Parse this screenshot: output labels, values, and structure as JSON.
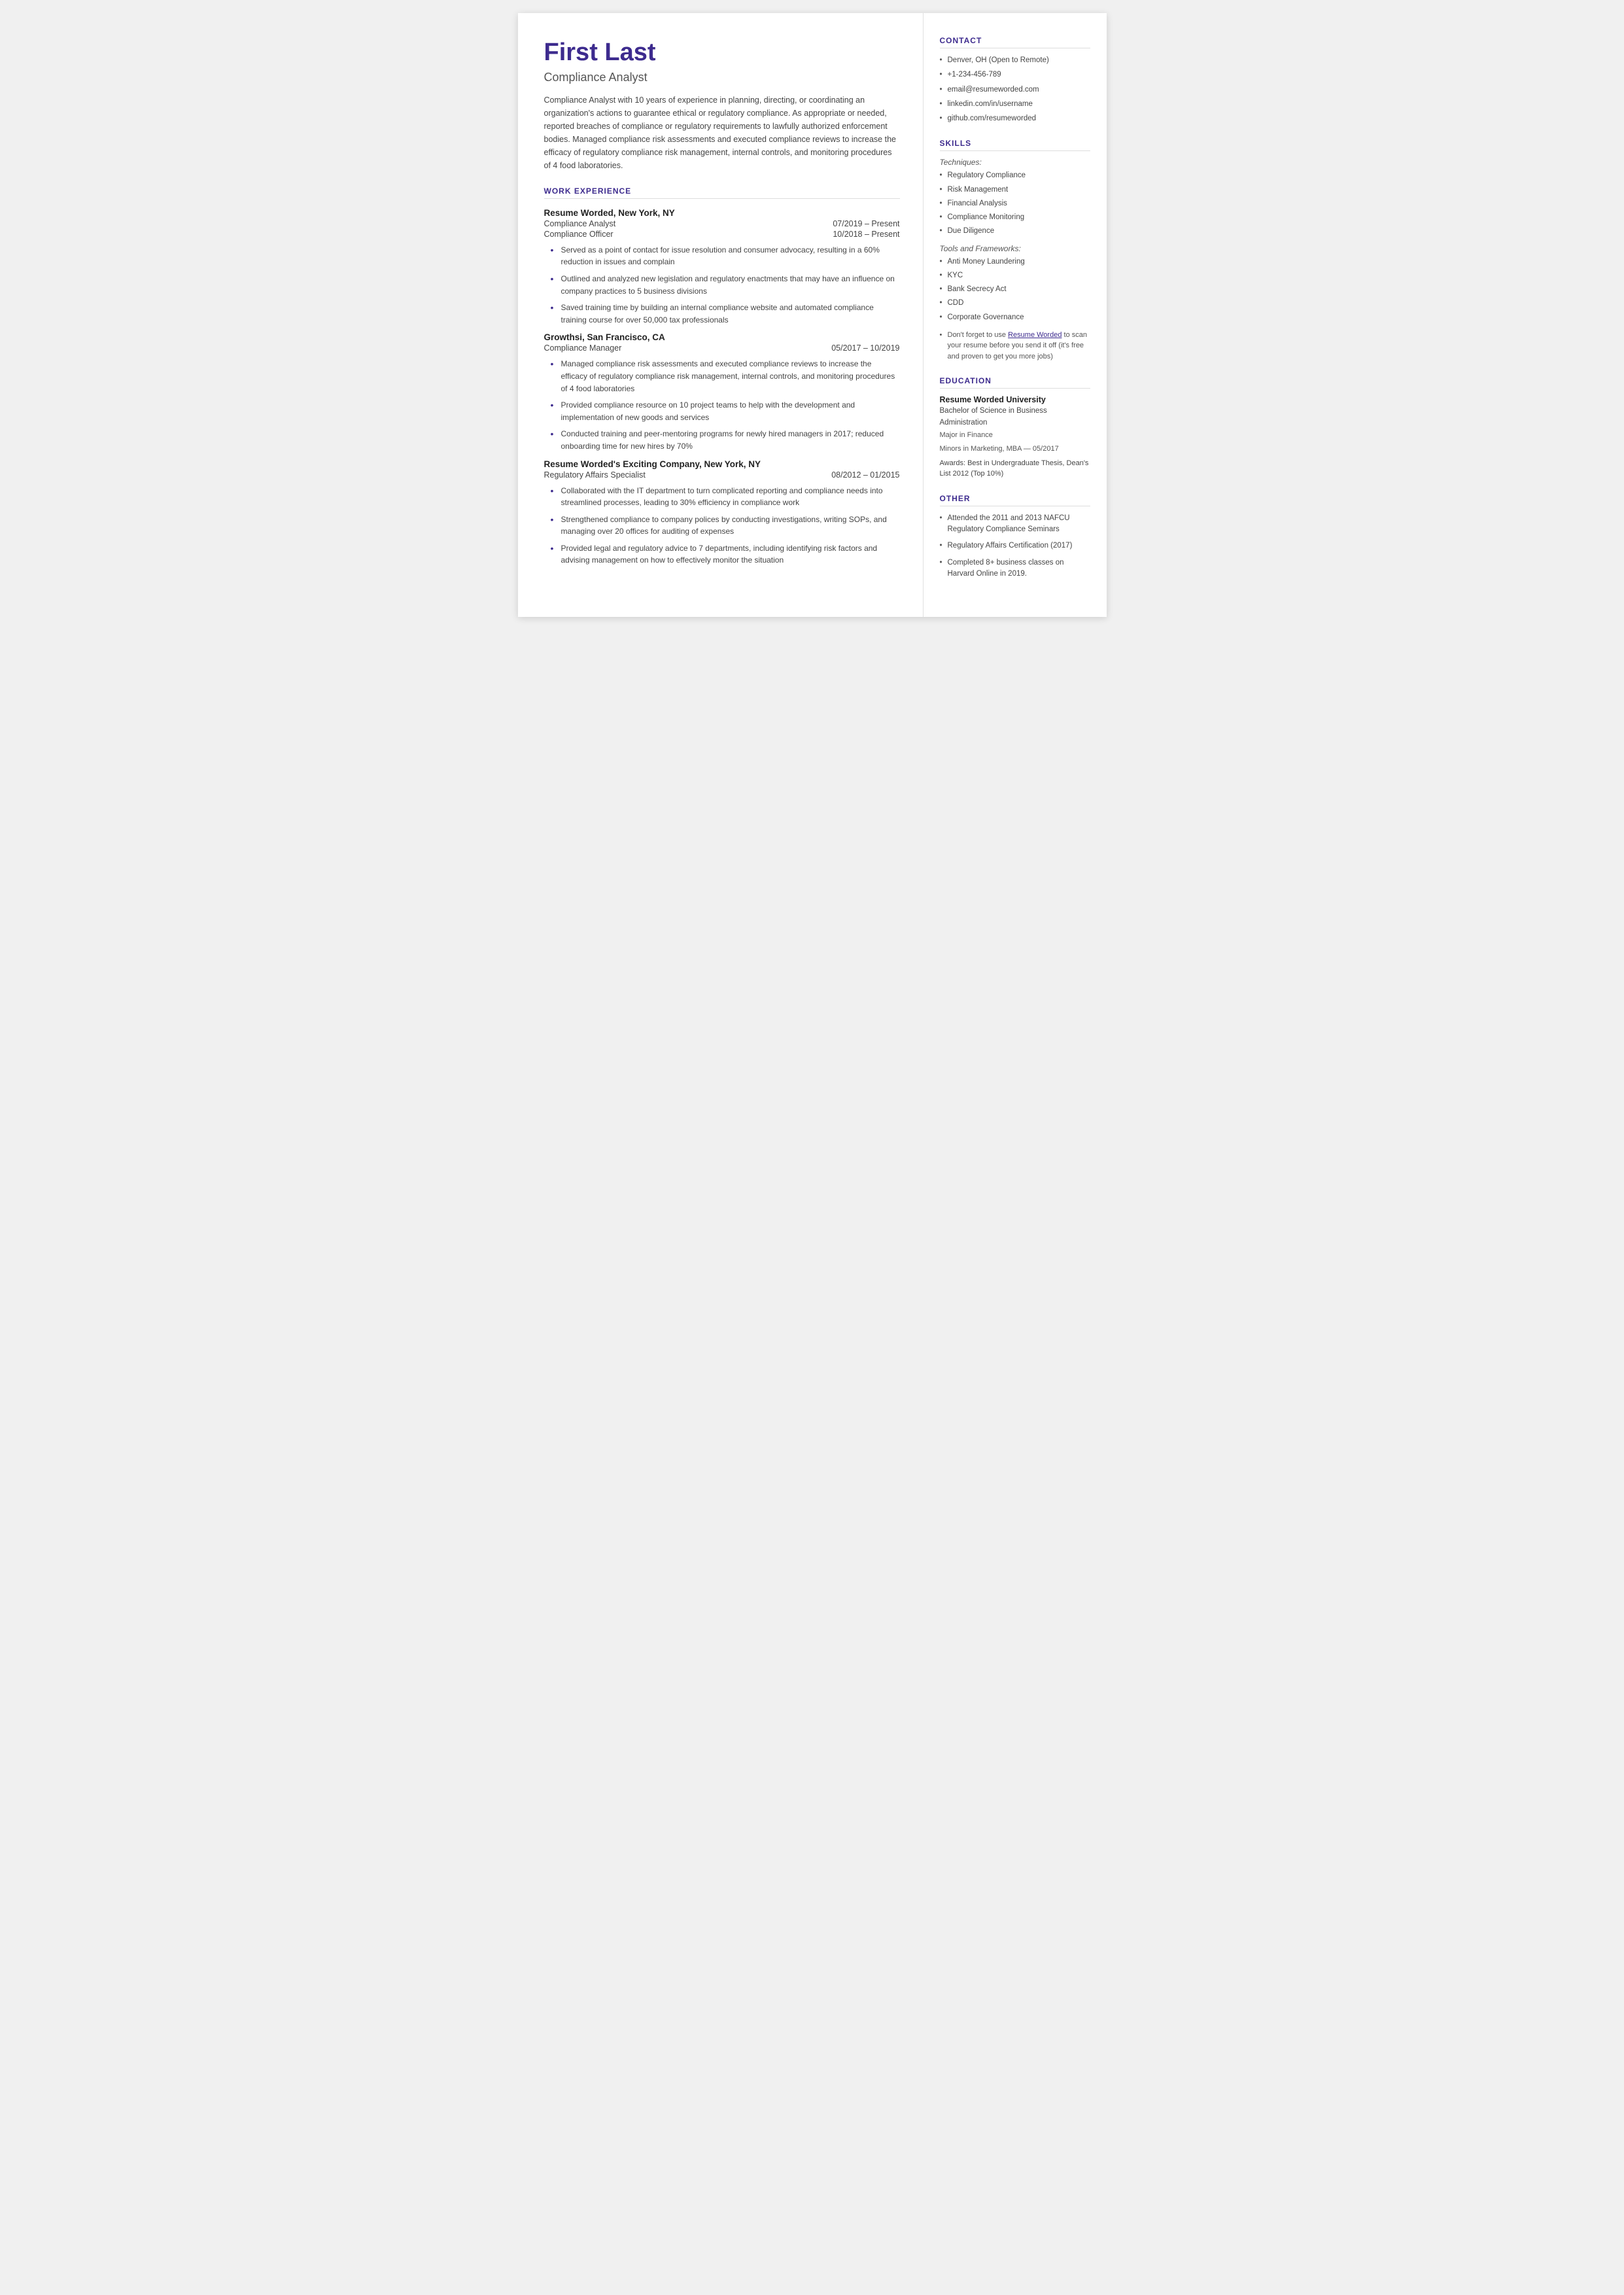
{
  "header": {
    "name": "First Last",
    "title": "Compliance Analyst",
    "summary": "Compliance Analyst with 10 years of experience in planning, directing, or coordinating an organization's actions to guarantee ethical or regulatory compliance. As appropriate or needed, reported breaches of compliance or regulatory requirements to lawfully authorized enforcement bodies. Managed compliance risk assessments and executed compliance reviews to increase the efficacy of regulatory compliance risk management, internal controls, and monitoring procedures of 4 food laboratories."
  },
  "work_experience": {
    "section_label": "WORK EXPERIENCE",
    "jobs": [
      {
        "company": "Resume Worded, New York, NY",
        "roles": [
          {
            "title": "Compliance Analyst",
            "dates": "07/2019 – Present"
          },
          {
            "title": "Compliance Officer",
            "dates": "10/2018 – Present"
          }
        ],
        "bullets": [
          "Served as a point of contact for issue resolution and consumer advocacy, resulting in a 60% reduction in issues and complain",
          "Outlined and analyzed new legislation and regulatory enactments that may have an influence on company practices to 5 business divisions",
          "Saved training time by building an internal compliance website and automated compliance training course for over 50,000 tax professionals"
        ]
      },
      {
        "company": "Growthsi, San Francisco, CA",
        "roles": [
          {
            "title": "Compliance Manager",
            "dates": "05/2017 – 10/2019"
          }
        ],
        "bullets": [
          "Managed compliance risk assessments and executed compliance reviews to increase the efficacy of regulatory compliance risk management, internal controls, and monitoring procedures of 4 food laboratories",
          "Provided compliance resource on 10 project teams to help with the development and implementation of new goods and services",
          "Conducted training and peer-mentoring programs for newly hired managers in 2017; reduced onboarding time for new hires by 70%"
        ]
      },
      {
        "company": "Resume Worded's Exciting Company, New York, NY",
        "roles": [
          {
            "title": "Regulatory Affairs Specialist",
            "dates": "08/2012 – 01/2015"
          }
        ],
        "bullets": [
          "Collaborated with the IT department to turn complicated reporting and compliance needs into streamlined processes, leading to 30% efficiency in compliance work",
          "Strengthened compliance to company polices by conducting investigations, writing SOPs, and managing over 20 offices for auditing of expenses",
          "Provided legal and regulatory advice to 7 departments, including identifying risk factors and advising management on how to effectively monitor the situation"
        ]
      }
    ]
  },
  "contact": {
    "section_label": "CONTACT",
    "items": [
      "Denver, OH (Open to Remote)",
      "+1-234-456-789",
      "email@resumeworded.com",
      "linkedin.com/in/username",
      "github.com/resumeworded"
    ]
  },
  "skills": {
    "section_label": "SKILLS",
    "techniques_label": "Techniques:",
    "techniques": [
      "Regulatory Compliance",
      "Risk Management",
      "Financial Analysis",
      "Compliance Monitoring",
      "Due Diligence"
    ],
    "tools_label": "Tools and Frameworks:",
    "tools": [
      "Anti Money Laundering",
      "KYC",
      "Bank Secrecy Act",
      "CDD",
      "Corporate Governance"
    ],
    "note_prefix": "Don't forget to use ",
    "note_link_text": "Resume Worded",
    "note_suffix": " to scan your resume before you send it off (it's free and proven to get you more jobs)"
  },
  "education": {
    "section_label": "EDUCATION",
    "school": "Resume Worded University",
    "degree": "Bachelor of Science in Business Administration",
    "major": "Major in Finance",
    "minors": "Minors in Marketing, MBA — 05/2017",
    "awards": "Awards: Best in Undergraduate Thesis, Dean's List 2012 (Top 10%)"
  },
  "other": {
    "section_label": "OTHER",
    "items": [
      "Attended the 2011 and 2013 NAFCU Regulatory Compliance Seminars",
      "Regulatory Affairs Certification (2017)",
      "Completed 8+ business classes on Harvard Online in 2019."
    ]
  }
}
